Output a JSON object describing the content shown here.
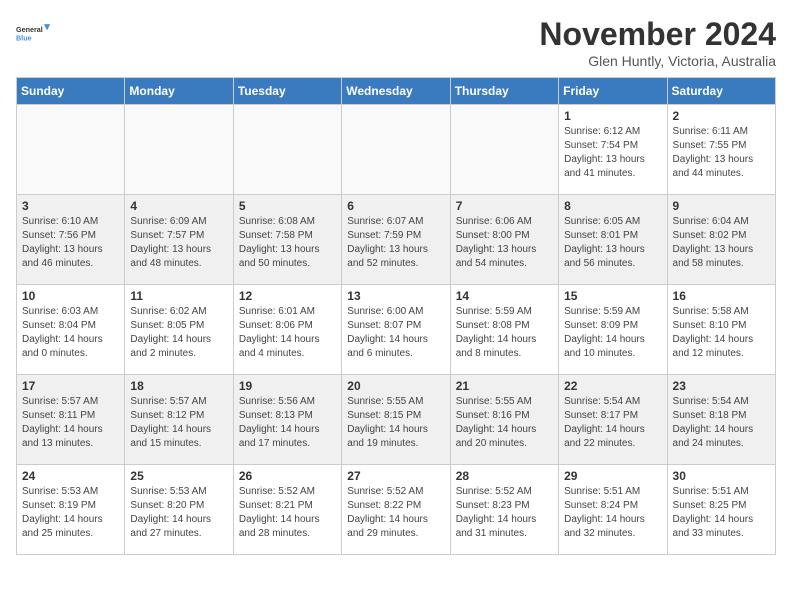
{
  "header": {
    "logo_line1": "General",
    "logo_line2": "Blue",
    "month": "November 2024",
    "location": "Glen Huntly, Victoria, Australia"
  },
  "weekdays": [
    "Sunday",
    "Monday",
    "Tuesday",
    "Wednesday",
    "Thursday",
    "Friday",
    "Saturday"
  ],
  "weeks": [
    [
      {
        "day": "",
        "info": ""
      },
      {
        "day": "",
        "info": ""
      },
      {
        "day": "",
        "info": ""
      },
      {
        "day": "",
        "info": ""
      },
      {
        "day": "",
        "info": ""
      },
      {
        "day": "1",
        "info": "Sunrise: 6:12 AM\nSunset: 7:54 PM\nDaylight: 13 hours\nand 41 minutes."
      },
      {
        "day": "2",
        "info": "Sunrise: 6:11 AM\nSunset: 7:55 PM\nDaylight: 13 hours\nand 44 minutes."
      }
    ],
    [
      {
        "day": "3",
        "info": "Sunrise: 6:10 AM\nSunset: 7:56 PM\nDaylight: 13 hours\nand 46 minutes."
      },
      {
        "day": "4",
        "info": "Sunrise: 6:09 AM\nSunset: 7:57 PM\nDaylight: 13 hours\nand 48 minutes."
      },
      {
        "day": "5",
        "info": "Sunrise: 6:08 AM\nSunset: 7:58 PM\nDaylight: 13 hours\nand 50 minutes."
      },
      {
        "day": "6",
        "info": "Sunrise: 6:07 AM\nSunset: 7:59 PM\nDaylight: 13 hours\nand 52 minutes."
      },
      {
        "day": "7",
        "info": "Sunrise: 6:06 AM\nSunset: 8:00 PM\nDaylight: 13 hours\nand 54 minutes."
      },
      {
        "day": "8",
        "info": "Sunrise: 6:05 AM\nSunset: 8:01 PM\nDaylight: 13 hours\nand 56 minutes."
      },
      {
        "day": "9",
        "info": "Sunrise: 6:04 AM\nSunset: 8:02 PM\nDaylight: 13 hours\nand 58 minutes."
      }
    ],
    [
      {
        "day": "10",
        "info": "Sunrise: 6:03 AM\nSunset: 8:04 PM\nDaylight: 14 hours\nand 0 minutes."
      },
      {
        "day": "11",
        "info": "Sunrise: 6:02 AM\nSunset: 8:05 PM\nDaylight: 14 hours\nand 2 minutes."
      },
      {
        "day": "12",
        "info": "Sunrise: 6:01 AM\nSunset: 8:06 PM\nDaylight: 14 hours\nand 4 minutes."
      },
      {
        "day": "13",
        "info": "Sunrise: 6:00 AM\nSunset: 8:07 PM\nDaylight: 14 hours\nand 6 minutes."
      },
      {
        "day": "14",
        "info": "Sunrise: 5:59 AM\nSunset: 8:08 PM\nDaylight: 14 hours\nand 8 minutes."
      },
      {
        "day": "15",
        "info": "Sunrise: 5:59 AM\nSunset: 8:09 PM\nDaylight: 14 hours\nand 10 minutes."
      },
      {
        "day": "16",
        "info": "Sunrise: 5:58 AM\nSunset: 8:10 PM\nDaylight: 14 hours\nand 12 minutes."
      }
    ],
    [
      {
        "day": "17",
        "info": "Sunrise: 5:57 AM\nSunset: 8:11 PM\nDaylight: 14 hours\nand 13 minutes."
      },
      {
        "day": "18",
        "info": "Sunrise: 5:57 AM\nSunset: 8:12 PM\nDaylight: 14 hours\nand 15 minutes."
      },
      {
        "day": "19",
        "info": "Sunrise: 5:56 AM\nSunset: 8:13 PM\nDaylight: 14 hours\nand 17 minutes."
      },
      {
        "day": "20",
        "info": "Sunrise: 5:55 AM\nSunset: 8:15 PM\nDaylight: 14 hours\nand 19 minutes."
      },
      {
        "day": "21",
        "info": "Sunrise: 5:55 AM\nSunset: 8:16 PM\nDaylight: 14 hours\nand 20 minutes."
      },
      {
        "day": "22",
        "info": "Sunrise: 5:54 AM\nSunset: 8:17 PM\nDaylight: 14 hours\nand 22 minutes."
      },
      {
        "day": "23",
        "info": "Sunrise: 5:54 AM\nSunset: 8:18 PM\nDaylight: 14 hours\nand 24 minutes."
      }
    ],
    [
      {
        "day": "24",
        "info": "Sunrise: 5:53 AM\nSunset: 8:19 PM\nDaylight: 14 hours\nand 25 minutes."
      },
      {
        "day": "25",
        "info": "Sunrise: 5:53 AM\nSunset: 8:20 PM\nDaylight: 14 hours\nand 27 minutes."
      },
      {
        "day": "26",
        "info": "Sunrise: 5:52 AM\nSunset: 8:21 PM\nDaylight: 14 hours\nand 28 minutes."
      },
      {
        "day": "27",
        "info": "Sunrise: 5:52 AM\nSunset: 8:22 PM\nDaylight: 14 hours\nand 29 minutes."
      },
      {
        "day": "28",
        "info": "Sunrise: 5:52 AM\nSunset: 8:23 PM\nDaylight: 14 hours\nand 31 minutes."
      },
      {
        "day": "29",
        "info": "Sunrise: 5:51 AM\nSunset: 8:24 PM\nDaylight: 14 hours\nand 32 minutes."
      },
      {
        "day": "30",
        "info": "Sunrise: 5:51 AM\nSunset: 8:25 PM\nDaylight: 14 hours\nand 33 minutes."
      }
    ]
  ]
}
